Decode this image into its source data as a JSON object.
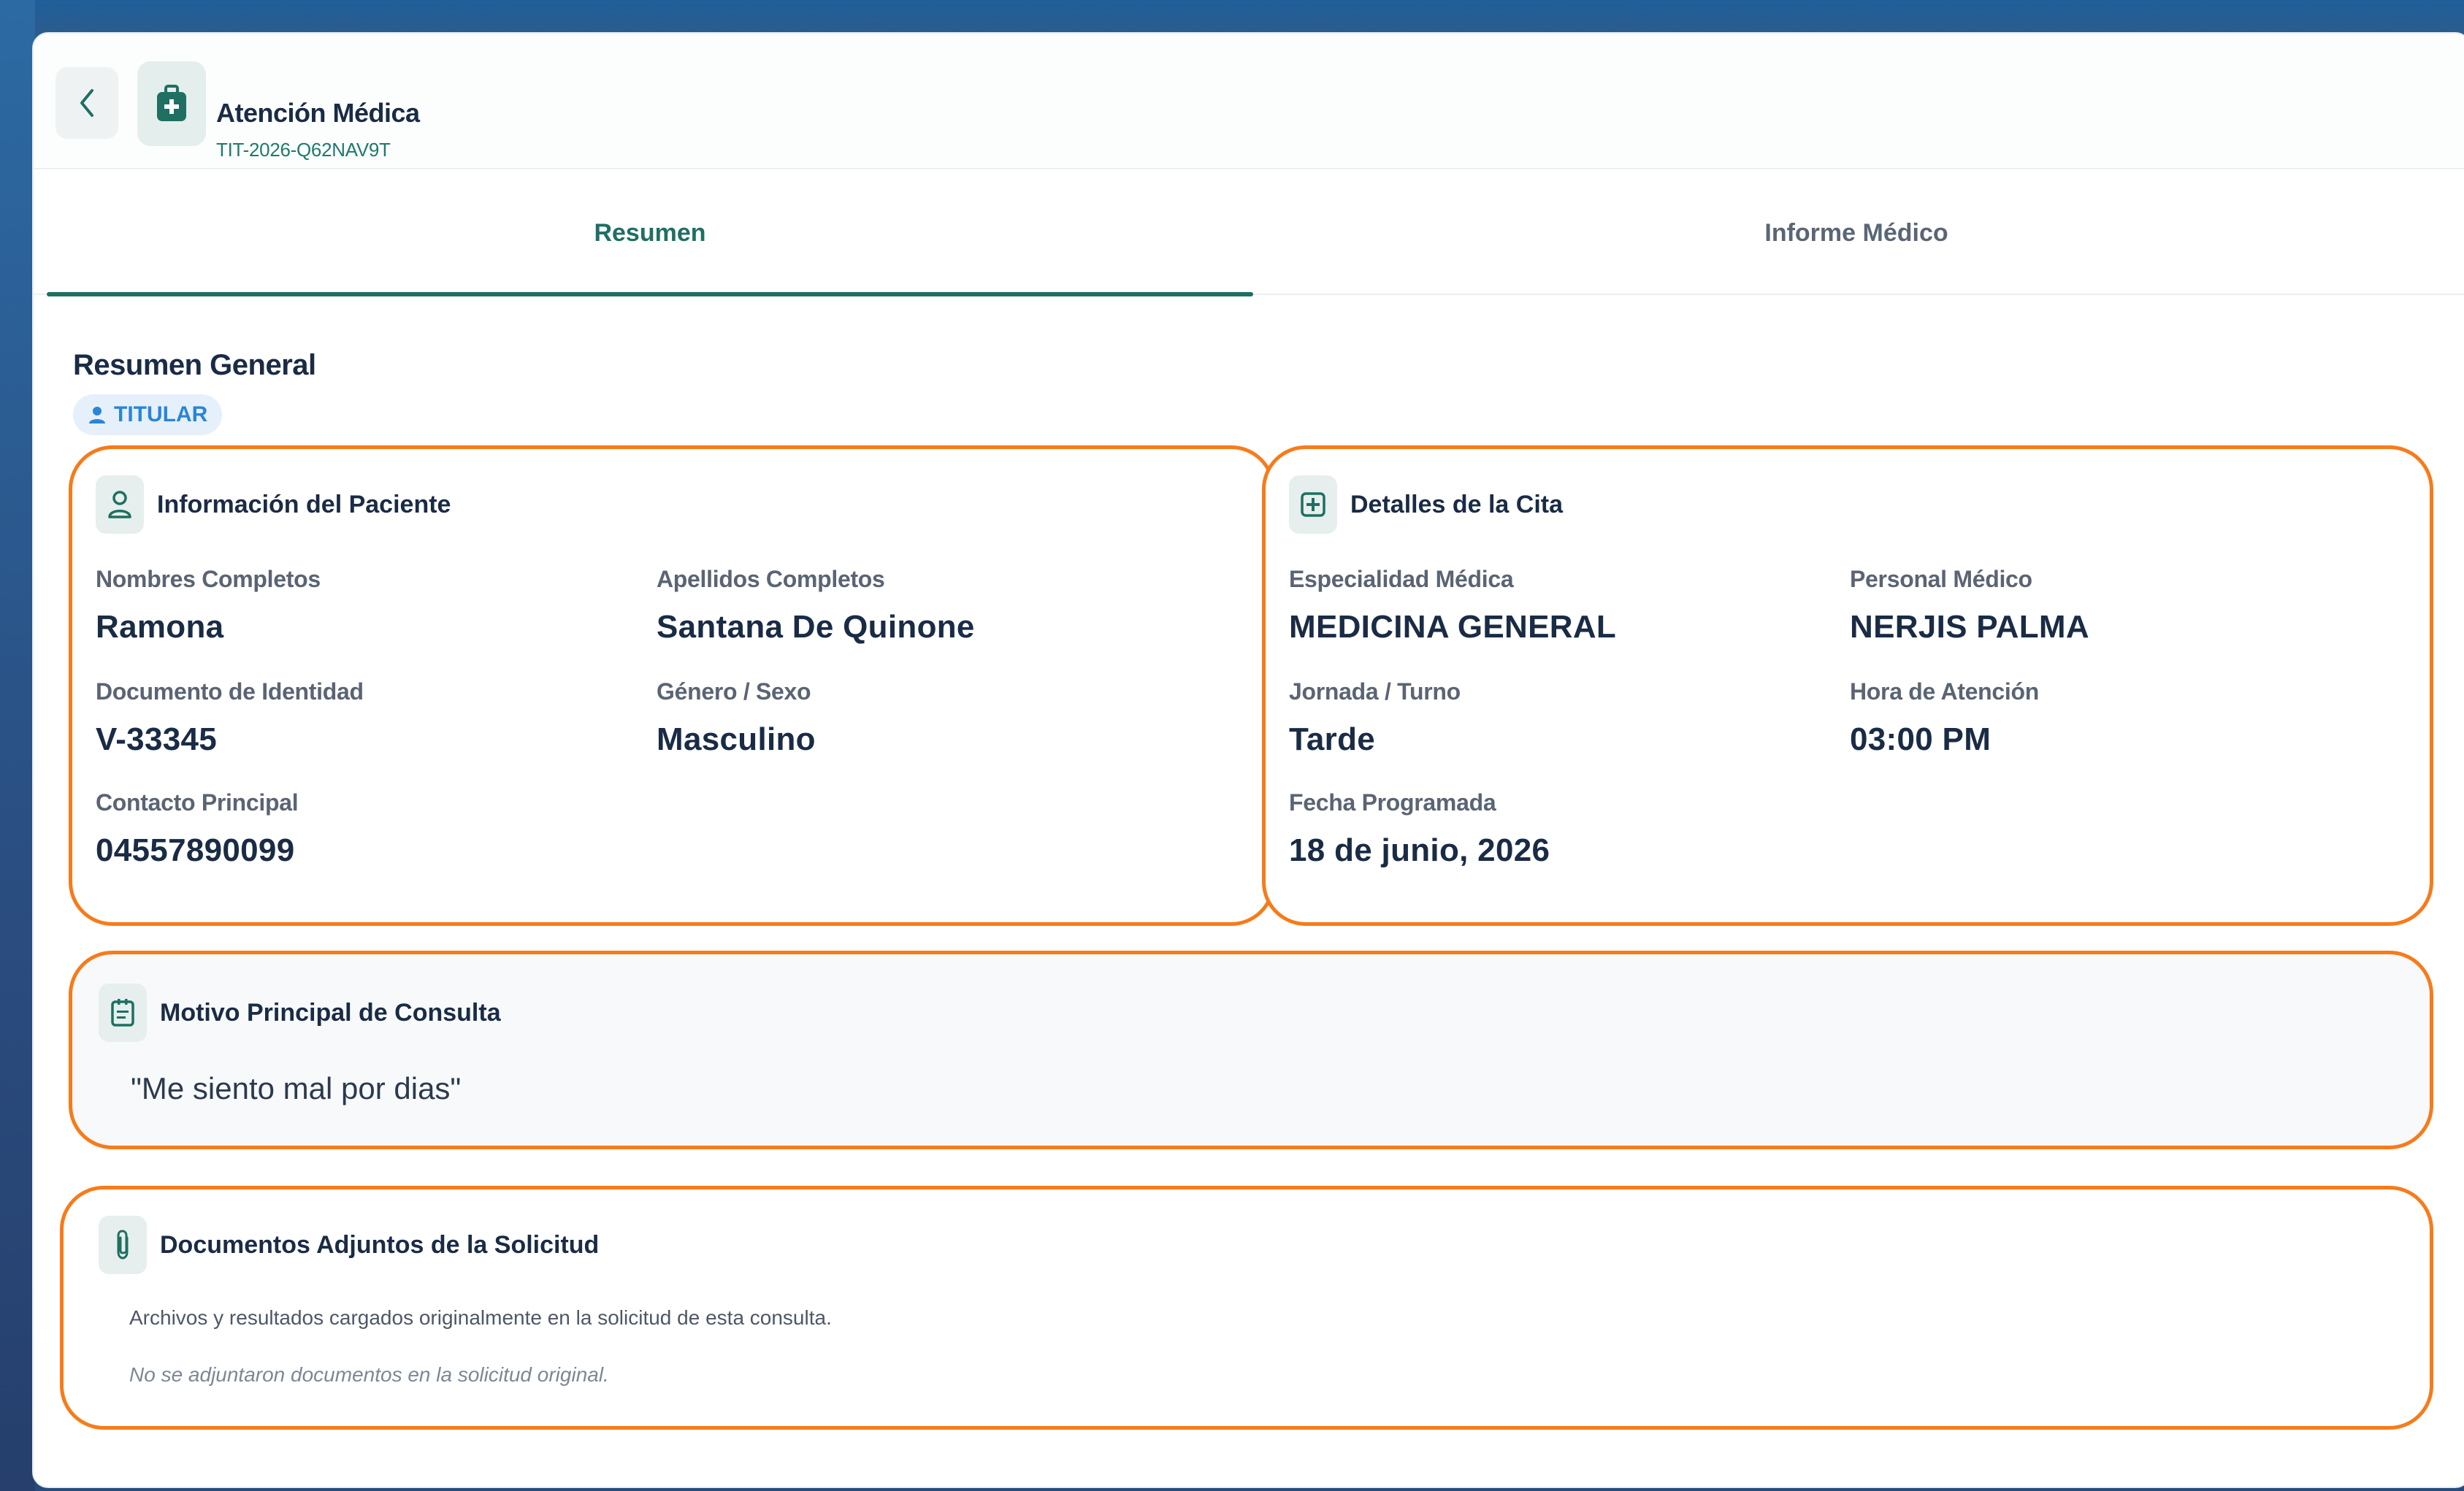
{
  "header": {
    "title": "Atención Médica",
    "subtitle": "TIT-2026-Q62NAV9T"
  },
  "tabs": [
    {
      "label": "Resumen",
      "active": true
    },
    {
      "label": "Informe Médico",
      "active": false
    }
  ],
  "section": {
    "title": "Resumen General",
    "badge": "TITULAR"
  },
  "patient_card": {
    "title": "Información del Paciente",
    "fields": [
      {
        "label": "Nombres Completos",
        "value": "Ramona"
      },
      {
        "label": "Apellidos Completos",
        "value": "Santana De Quinone"
      },
      {
        "label": "Documento de Identidad",
        "value": "V-33345"
      },
      {
        "label": "Género / Sexo",
        "value": "Masculino"
      },
      {
        "label": "Contacto Principal",
        "value": "04557890099"
      }
    ]
  },
  "appointment_card": {
    "title": "Detalles de la Cita",
    "fields": [
      {
        "label": "Especialidad Médica",
        "value": "MEDICINA GENERAL"
      },
      {
        "label": "Personal Médico",
        "value": "NERJIS PALMA"
      },
      {
        "label": "Jornada / Turno",
        "value": "Tarde"
      },
      {
        "label": "Hora de Atención",
        "value": "03:00 PM"
      },
      {
        "label": "Fecha Programada",
        "value": "18 de junio, 2026"
      }
    ]
  },
  "reason_card": {
    "title": "Motivo Principal de Consulta",
    "text": "\"Me siento mal por dias\""
  },
  "documents_card": {
    "title": "Documentos Adjuntos de la Solicitud",
    "description": "Archivos y resultados cargados originalmente en la solicitud de esta consulta.",
    "empty_message": "No se adjuntaron documentos en la solicitud original."
  },
  "colors": {
    "accent": "#1f6f62",
    "highlight_border": "#f77b1a",
    "badge_text": "#2a85d6",
    "text_dark": "#1a2b45"
  }
}
